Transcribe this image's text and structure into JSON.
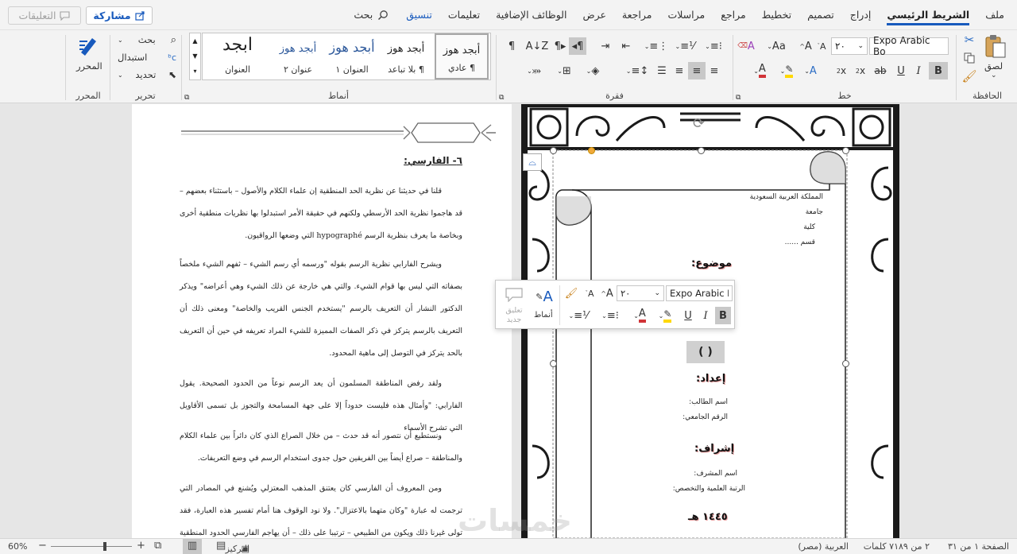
{
  "tabs": {
    "items": [
      "ملف",
      "الشريط الرئيسي",
      "إدراج",
      "تصميم",
      "تخطيط",
      "مراجع",
      "مراسلات",
      "مراجعة",
      "عرض",
      "الوظائف الإضافية",
      "تعليمات",
      "تنسيق"
    ],
    "search": "بحث",
    "share": "مشاركة",
    "comments": "التعليقات"
  },
  "ribbon": {
    "clipboard": {
      "paste": "لصق",
      "label": "الحافظة"
    },
    "font": {
      "name": "Expo Arabic Bo",
      "size": "٢٠",
      "label": "خط"
    },
    "paragraph": {
      "label": "فقرة"
    },
    "styles": {
      "items": [
        {
          "preview": "أبجد هوز",
          "name": "¶ عادي"
        },
        {
          "preview": "أبجد هوز",
          "name": "¶ بلا تباعد"
        },
        {
          "preview": "أبجد هوز",
          "name": "العنوان ١"
        },
        {
          "preview": "أبجد هوز",
          "name": "عنوان ٢"
        },
        {
          "preview": "ابجد",
          "name": "العنوان"
        }
      ],
      "label": "أنماط"
    },
    "editing": {
      "find": "بحث",
      "replace": "استبدال",
      "select": "تحديد",
      "label": "تحرير"
    },
    "editor": {
      "name": "المحرر",
      "label": "المحرر"
    }
  },
  "page1": {
    "heading": "٦- الفارسي:",
    "paragraphs": [
      "قلنا في حديثنا عن نظرية الحد المنطقية إن علماء الكلام والأصول – باستثناء بعضهم – قد هاجموا نظرية الحد الأرسطي ولكنهم في حقيقة الأمر استبدلوا بها نظريات منطقية أخرى وبخاصة ما يعرف بنظرية الرسم hypographé التي وضعها الرواقيون.",
      "ويشرح الفارابي نظرية الرسم بقوله \"ورسمه أي رسم الشيء – ثفهم الشيء ملخصاً بصفاته التي ليس بها قوام الشيء. والتي هي خارجة عن ذلك الشيء وهي أعراضه\" ويذكر الدكتور النشار أن التعريف بالرسم \"يستخدم الجنس القريب والخاصة\" ومعنى ذلك أن التعريف بالرسم يتركز في ذكر الصفات المميزة للشيء المراد تعريفه في حين أن التعريف بالحد يتركز في التوصل إلى ماهية المحدود.",
      "ولقد رفض المناطقة المسلمون أن يعد الرسم نوعاً من الحدود الصحيحة. يقول الفارابي: \"وأمثال هذه فليست حدوداً إلا على جهة المسامحة والتجوز بل تسمى الأقاويل التي تشرح الأسماء",
      "ونستطيع أن نتصور أنه قد حدث – من خلال الصراع الذي كان دائراً بين علماء الكلام والمناطقة – صراع أيضاً بين الفريقين حول جدوى استخدام الرسم في وضع التعريفات.",
      "ومن المعروف أن الفارسي كان يعتنق المذهب المعتزلي ويُشنع في المصادر التي ترجمت له عبارة \"وكان متهما بالاعتزال\". ولا نود الوقوف هنا أمام تفسير هذه العبارة، فقد تولى غيرنا ذلك ويكون من الطبيعي – ترتيبا على ذلك – أن يهاجم الفارسي الحدود المنطقية والآخذين بها من النحاة، ومن"
    ]
  },
  "page2": {
    "header": [
      "المملكة العربية السعودية",
      "جامعة",
      "كلية",
      "قسم ......"
    ],
    "topic": "موضوع:",
    "paren": "(   )",
    "prepared": "إعداد:",
    "student": [
      "اسم الطالب:",
      "الرقم الجامعي:"
    ],
    "supervision": "إشراف:",
    "supervisor": [
      "اسم المشرف:",
      "الرتبة العلمية والتخصص:"
    ],
    "year": "١٤٤٥ هـ"
  },
  "minitoolbar": {
    "font": "Expo Arabic Bo",
    "size": "٢٠",
    "styles": "أنماط",
    "comment": "تعليق جديد"
  },
  "status": {
    "page": "الصفحة ١ من ٣١",
    "words": "٢ من ٧١٨٩ كلمات",
    "lang": "العربية (مصر)",
    "focus": "التركيز",
    "zoom": "60%"
  },
  "watermark": "خمسات",
  "colors": {
    "accent": "#185abd",
    "fontRed": "#d13438",
    "highlight": "#ffd800"
  }
}
